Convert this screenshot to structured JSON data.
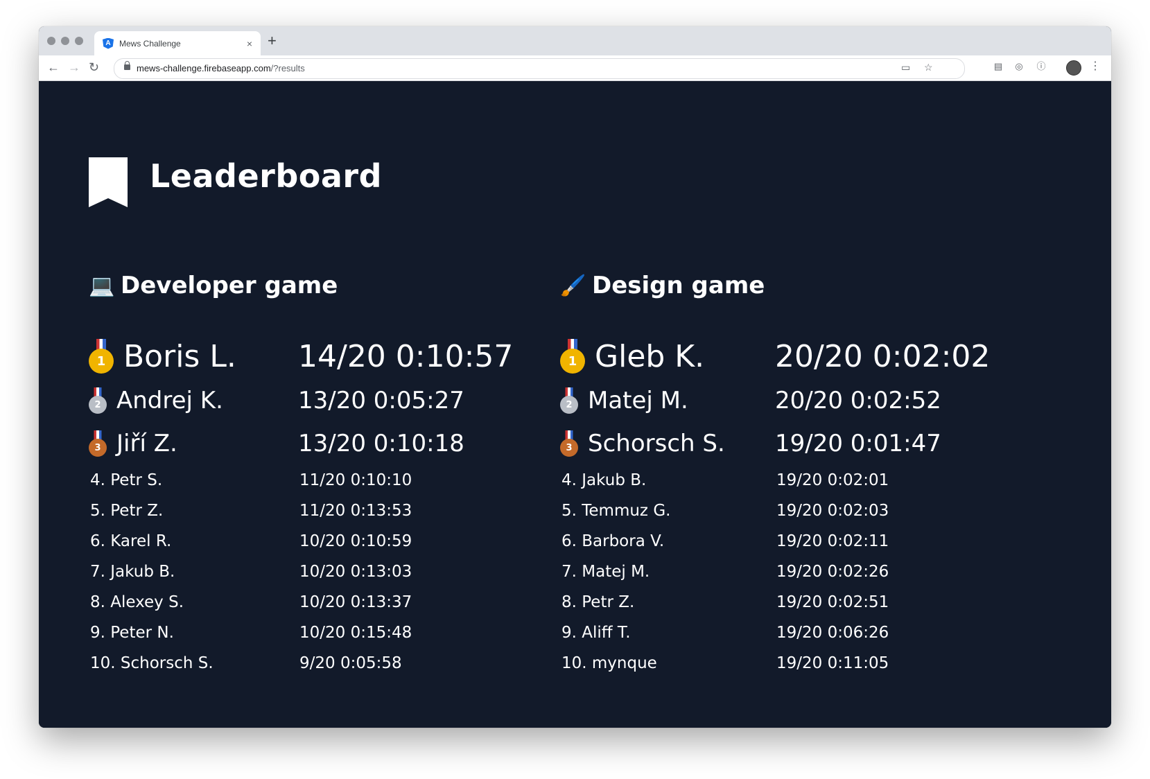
{
  "browser": {
    "tab_title": "Mews Challenge",
    "tab_close": "×",
    "new_tab": "+",
    "url_host": "mews-challenge.firebaseapp.com",
    "url_path": "/?results",
    "back": "←",
    "forward": "→",
    "reload": "↻",
    "star": "☆",
    "menu": "⋮"
  },
  "page": {
    "title": "Leaderboard"
  },
  "sections": [
    {
      "emoji": "💻",
      "title": "Developer game",
      "top": [
        {
          "medal": "1",
          "name": "Boris L.",
          "score": "14/20 0:10:57"
        },
        {
          "medal": "2",
          "name": "Andrej K.",
          "score": "13/20 0:05:27"
        },
        {
          "medal": "3",
          "name": "Jiří Z.",
          "score": "13/20 0:10:18"
        }
      ],
      "rest": [
        {
          "name": "4. Petr S.",
          "score": "11/20 0:10:10"
        },
        {
          "name": "5. Petr Z.",
          "score": "11/20 0:13:53"
        },
        {
          "name": "6. Karel R.",
          "score": "10/20 0:10:59"
        },
        {
          "name": "7. Jakub B.",
          "score": "10/20 0:13:03"
        },
        {
          "name": "8. Alexey S.",
          "score": "10/20 0:13:37"
        },
        {
          "name": "9. Peter N.",
          "score": "10/20 0:15:48"
        },
        {
          "name": "10. Schorsch S.",
          "score": "9/20 0:05:58"
        }
      ]
    },
    {
      "emoji": "🖌️",
      "title": "Design game",
      "top": [
        {
          "medal": "1",
          "name": "Gleb K.",
          "score": "20/20 0:02:02"
        },
        {
          "medal": "2",
          "name": "Matej M.",
          "score": "20/20 0:02:52"
        },
        {
          "medal": "3",
          "name": "Schorsch S.",
          "score": "19/20 0:01:47"
        }
      ],
      "rest": [
        {
          "name": "4. Jakub B.",
          "score": "19/20 0:02:01"
        },
        {
          "name": "5. Temmuz G.",
          "score": "19/20 0:02:03"
        },
        {
          "name": "6. Barbora V.",
          "score": "19/20 0:02:11"
        },
        {
          "name": "7. Matej M.",
          "score": "19/20 0:02:26"
        },
        {
          "name": "8. Petr Z.",
          "score": "19/20 0:02:51"
        },
        {
          "name": "9. Aliff T.",
          "score": "19/20 0:06:26"
        },
        {
          "name": "10. mynque",
          "score": "19/20 0:11:05"
        }
      ]
    }
  ]
}
